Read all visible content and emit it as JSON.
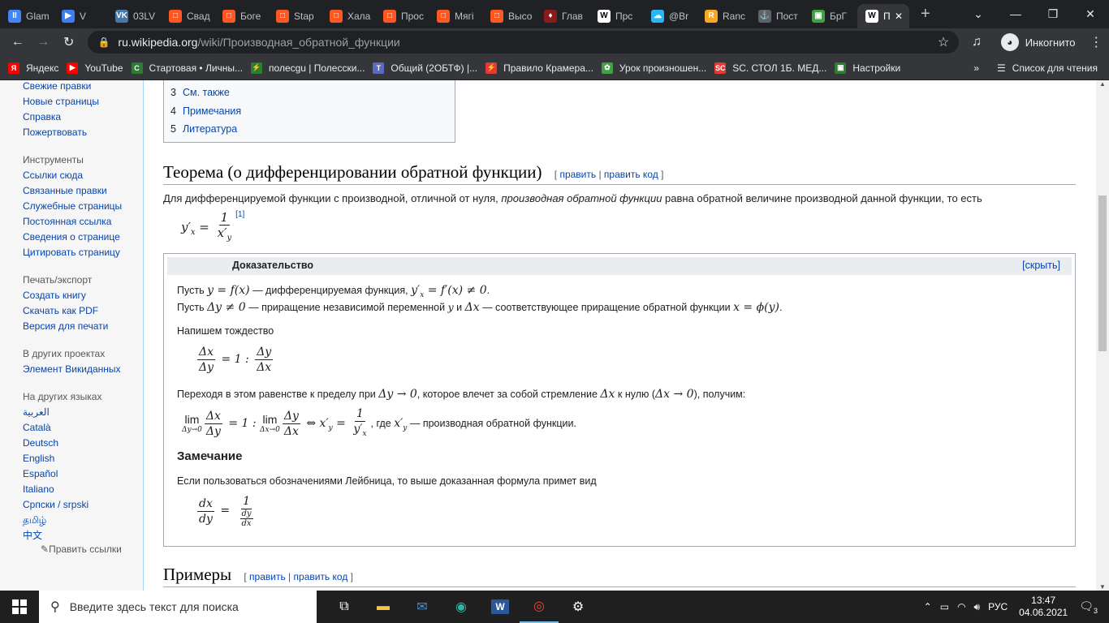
{
  "browser": {
    "tabs": [
      {
        "label": "Glam",
        "color": "#4285f4",
        "g": "II"
      },
      {
        "label": "V",
        "color": "#3d7ff2",
        "g": "▶"
      },
      {
        "label": "03LV",
        "color": "#4a76a8",
        "g": "VK"
      },
      {
        "label": "Свад",
        "color": "#ff5722",
        "g": "□"
      },
      {
        "label": "Боге",
        "color": "#ff5722",
        "g": "□"
      },
      {
        "label": "Stap",
        "color": "#ff5722",
        "g": "□"
      },
      {
        "label": "Хала",
        "color": "#ff5722",
        "g": "□"
      },
      {
        "label": "Прос",
        "color": "#ff5722",
        "g": "□"
      },
      {
        "label": "Мягі",
        "color": "#ff5722",
        "g": "□"
      },
      {
        "label": "Высо",
        "color": "#ff5722",
        "g": "□"
      },
      {
        "label": "Глав",
        "color": "#8b1a1a",
        "g": "♦"
      },
      {
        "label": "Прс",
        "color": "#ffffff",
        "g": "W"
      },
      {
        "label": "@Br",
        "color": "#29b6f6",
        "g": "☁"
      },
      {
        "label": "Ranc",
        "color": "#f9a825",
        "g": "R"
      },
      {
        "label": "Пост",
        "color": "#5f6368",
        "g": "⚓"
      },
      {
        "label": "БрГ",
        "color": "#43a047",
        "g": "▣"
      }
    ],
    "active_tab": {
      "label": "П",
      "color": "#ffffff",
      "g": "W"
    },
    "new_tab_label": "+",
    "url_host": "ru.wikipedia.org",
    "url_path": "/wiki/Производная_обратной_функции",
    "incognito_label": "Инкогнито",
    "bookmarks": [
      {
        "label": "Яндекс",
        "color": "#ff0000",
        "g": "Я"
      },
      {
        "label": "YouTube",
        "color": "#ff0000",
        "g": "▶"
      },
      {
        "label": "Стартовая • Личны...",
        "color": "#2e7d32",
        "g": "C"
      },
      {
        "label": "полесgu | Полесски...",
        "color": "#2e7d32",
        "g": "⚡"
      },
      {
        "label": "Общий (2ОБТФ) |...",
        "color": "#5c6bc0",
        "g": "T"
      },
      {
        "label": "Правило Крамера...",
        "color": "#e53935",
        "g": "⚡"
      },
      {
        "label": "Урок произношен...",
        "color": "#43a047",
        "g": "✿"
      },
      {
        "label": "SC. СТОЛ 1Б. МЕД...",
        "color": "#e53935",
        "g": "SC"
      },
      {
        "label": "Настройки",
        "color": "#2e7d32",
        "g": "▣"
      }
    ],
    "bookmarks_more": "»",
    "reading_list_label": "Список для чтения"
  },
  "sidebar": {
    "top_links": [
      "Свежие правки",
      "Новые страницы",
      "Справка",
      "Пожертвовать"
    ],
    "tools_heading": "Инструменты",
    "tools": [
      "Ссылки сюда",
      "Связанные правки",
      "Служебные страницы",
      "Постоянная ссылка",
      "Сведения о странице",
      "Цитировать страницу"
    ],
    "print_heading": "Печать/экспорт",
    "print": [
      "Создать книгу",
      "Скачать как PDF",
      "Версия для печати"
    ],
    "projects_heading": "В других проектах",
    "projects": [
      "Элемент Викиданных"
    ],
    "languages_heading": "На других языках",
    "languages": [
      "العربية",
      "Català",
      "Deutsch",
      "English",
      "Español",
      "Italiano",
      "Српски / srpski",
      "தமிழ்",
      "中文"
    ],
    "edit_links": "Править ссылки"
  },
  "toc": [
    {
      "n": "3",
      "label": "См. также"
    },
    {
      "n": "4",
      "label": "Примечания"
    },
    {
      "n": "5",
      "label": "Литература"
    }
  ],
  "section1": {
    "title": "Теорема (о дифференцировании обратной функции)",
    "edit": "править",
    "edit_code": "править код",
    "p1_a": "Для дифференцируемой функции с производной, отличной от нуля, ",
    "p1_i": "производная обратной функции",
    "p1_b": " равна обратной величине производной данной функции, то есть",
    "ref": "[1]"
  },
  "proof": {
    "title": "Доказательство",
    "hide": "[скрыть]",
    "l1a": "Пусть ",
    "l1b": " — дифференцируемая функция, ",
    "l2a": "Пусть ",
    "l2b": " — приращение независимой переменной ",
    "l2c": " и ",
    "l2d": " — соответствующее приращение обратной функции ",
    "l3": "Напишем тождество",
    "l4a": "Переходя в этом равенстве к пределу при ",
    "l4b": ", которое влечет за собой стремление ",
    "l4c": " к нулю (",
    "l4d": "), получим:",
    "l5": ", где ",
    "l5b": " — производная обратной функции.",
    "remark": "Замечание",
    "l6": "Если пользоваться обозначениями Лейбница, то выше доказанная формула примет вид"
  },
  "section2": {
    "title": "Примеры",
    "edit": "править",
    "edit_code": "править код"
  },
  "taskbar": {
    "search_placeholder": "Введите здесь текст для поиска",
    "lang": "РУС",
    "time": "13:47",
    "date": "04.06.2021",
    "notif_count": "3"
  }
}
